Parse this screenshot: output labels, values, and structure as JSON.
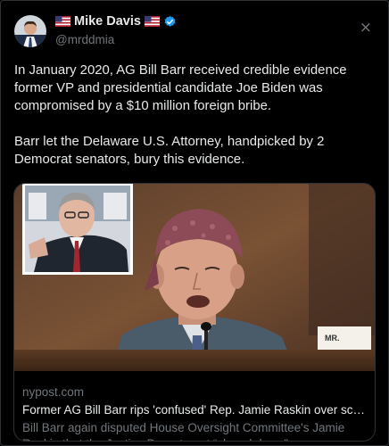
{
  "author": {
    "display_name": "Mike Davis",
    "handle": "@mrddmia",
    "avatar_icon": "profile-photo",
    "verified_color": "#1d9bf0"
  },
  "close_icon": "×",
  "tweet": {
    "paragraph_1": "In January 2020, AG Bill Barr received credible evidence former VP and presidential candidate Joe Biden was compromised by a $10 million foreign bribe.",
    "paragraph_2": "Barr let the Delaware U.S. Attorney, handpicked by 2 Democrat senators, bury this evidence."
  },
  "link_card": {
    "domain": "nypost.com",
    "headline": "Former AG Bill Barr rips 'confused' Rep. Jamie Raskin over scop...",
    "description": "Bill Barr again disputed House Oversight Committee's Jamie Raskin that the Justice Department “closed down” an ...",
    "nameplate_text": "MR."
  },
  "colors": {
    "background": "#000000",
    "text": "#e7e9ea",
    "muted": "#71767b",
    "border": "#2f3336",
    "accent": "#1d9bf0"
  }
}
